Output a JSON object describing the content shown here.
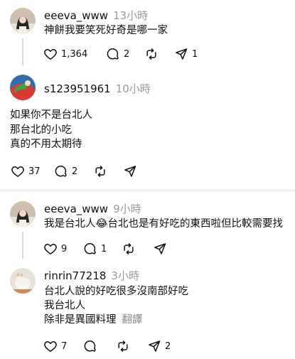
{
  "posts": [
    {
      "username": "eeeva_www",
      "time": "13小時",
      "lines": [
        "神餅我要笑死好奇是哪一家"
      ],
      "likes": "1,364",
      "comments": "2",
      "reposts": "",
      "shares": "1"
    },
    {
      "username": "s123951961",
      "time": "10小時",
      "lines": [
        "如果你不是台北人",
        "那台北的小吃",
        "真的不用太期待"
      ],
      "likes": "37",
      "comments": "2",
      "reposts": "",
      "shares": ""
    },
    {
      "username": "eeeva_www",
      "time": "9小時",
      "lines": [
        "我是台北人😂台北也是有好吃的東西啦但比較需要找"
      ],
      "likes": "9",
      "comments": "1",
      "reposts": "",
      "shares": ""
    },
    {
      "username": "rinrin77218",
      "time": "3小時",
      "lines": [
        "台北人說的好吃很多沒南部好吃",
        "我台北人",
        "除非是異國料理"
      ],
      "translate": "翻譯",
      "likes": "7",
      "comments": "",
      "reposts": "",
      "shares": "2"
    }
  ],
  "colors": {
    "text": "#101010",
    "muted": "#9a9a9a",
    "divider": "#e2e2e2",
    "thread_line": "#d9d9d9"
  },
  "icons": [
    "heart-icon",
    "comment-icon",
    "repost-icon",
    "share-icon"
  ]
}
